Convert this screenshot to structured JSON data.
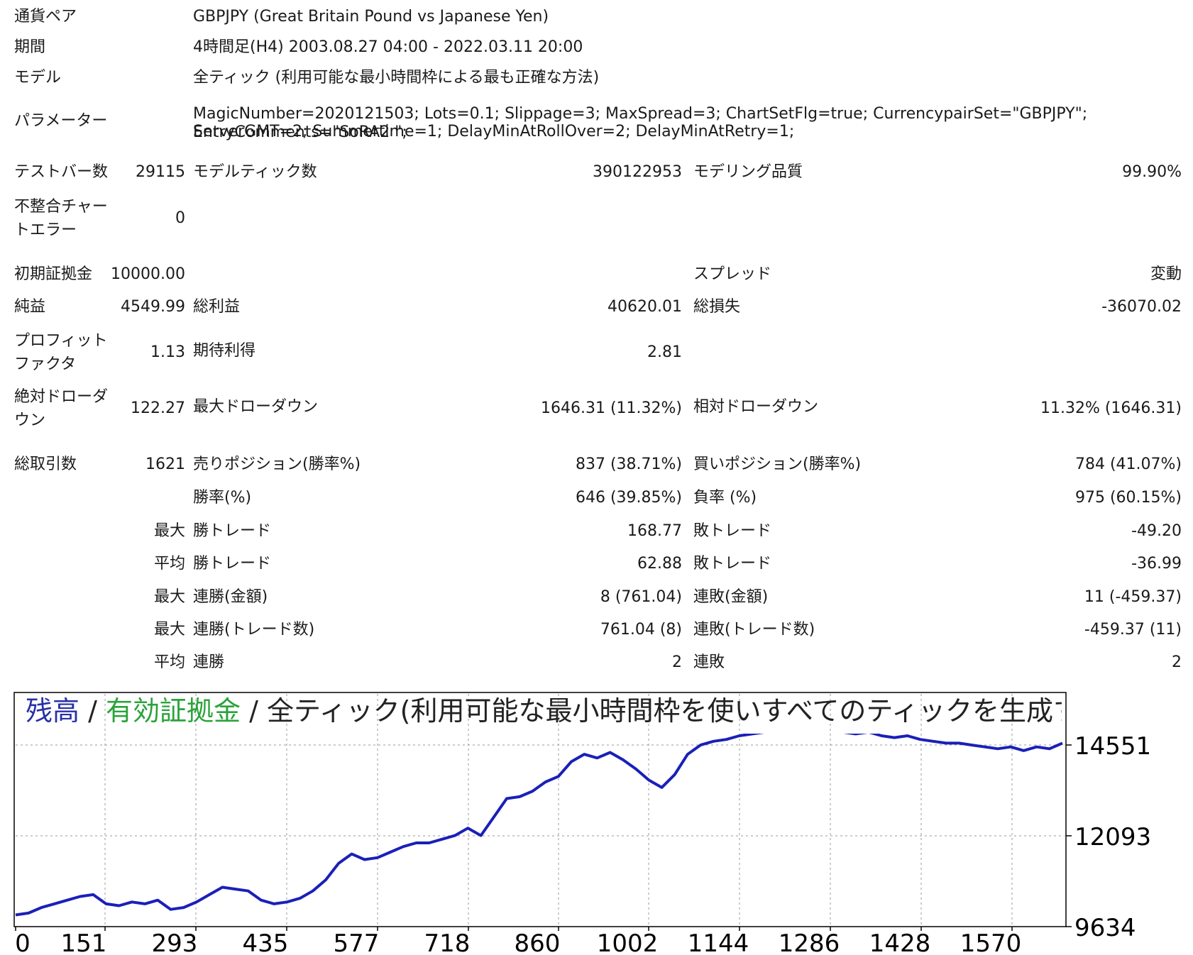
{
  "header": {
    "pair_label": "通貨ペア",
    "pair_value": "GBPJPY (Great Britain Pound vs Japanese Yen)",
    "period_label": "期間",
    "period_value": "4時間足(H4) 2003.08.27 04:00 - 2022.03.11 20:00",
    "model_label": "モデル",
    "model_value": "全ティック (利用可能な最小時間枠による最も正確な方法)",
    "params_label": "パラメーター",
    "params_line1": "MagicNumber=2020121503; Lots=0.1; Slippage=3; MaxSpread=3; ChartSetFlg=true; CurrencypairSet=\"GBPJPY\"; EntryComments=\"SoRA2 \";",
    "params_line2": "ServerGMT=2; Summertime=1; DelayMinAtRollOver=2; DelayMinAtRetry=1;"
  },
  "stats": {
    "bars_label": "テストバー数",
    "bars_value": "29115",
    "ticks_label": "モデルティック数",
    "ticks_value": "390122953",
    "quality_label": "モデリング品質",
    "quality_value": "99.90%",
    "mismatch_label": "不整合チャートエラー",
    "mismatch_value": "0",
    "deposit_label": "初期証拠金",
    "deposit_value": "10000.00",
    "spread_label": "スプレッド",
    "spread_value": "変動",
    "net_label": "純益",
    "net_value": "4549.99",
    "gross_profit_label": "総利益",
    "gross_profit_value": "40620.01",
    "gross_loss_label": "総損失",
    "gross_loss_value": "-36070.02",
    "pf_label": "プロフィットファクタ",
    "pf_value": "1.13",
    "expected_label": "期待利得",
    "expected_value": "2.81",
    "abs_dd_label": "絶対ドローダウン",
    "abs_dd_value": "122.27",
    "max_dd_label": "最大ドローダウン",
    "max_dd_value": "1646.31 (11.32%)",
    "rel_dd_label": "相対ドローダウン",
    "rel_dd_value": "11.32% (1646.31)",
    "trades_label": "総取引数",
    "trades_value": "1621",
    "short_label": "売りポジション(勝率%)",
    "short_value": "837 (38.71%)",
    "long_label": "買いポジション(勝率%)",
    "long_value": "784 (41.07%)",
    "win_label": "勝率(%)",
    "win_value": "646 (39.85%)",
    "loss_label": "負率 (%)",
    "loss_value": "975 (60.15%)",
    "largest_label": "最大",
    "largest_win_label": "勝トレード",
    "largest_win_value": "168.77",
    "largest_loss_label": "敗トレード",
    "largest_loss_value": "-49.20",
    "average_label": "平均",
    "avg_win_label": "勝トレード",
    "avg_win_value": "62.88",
    "avg_loss_label": "敗トレード",
    "avg_loss_value": "-36.99",
    "max_label_1": "最大",
    "consec_win_money_label": "連勝(金額)",
    "consec_win_money_value": "8 (761.04)",
    "consec_loss_money_label": "連敗(金額)",
    "consec_loss_money_value": "11 (-459.37)",
    "max_label_2": "最大",
    "consec_win_count_label": "連勝(トレード数)",
    "consec_win_count_value": "761.04 (8)",
    "consec_loss_count_label": "連敗(トレード数)",
    "consec_loss_count_value": "-459.37 (11)",
    "avg_label_2": "平均",
    "avg_consec_win_label": "連勝",
    "avg_consec_win_value": "2",
    "avg_consec_loss_label": "連敗",
    "avg_consec_loss_value": "2"
  },
  "chart_title": {
    "balance": "残高",
    "sep1": " / ",
    "equity": "有効証拠金",
    "rest": " / 全ティック(利用可能な最小時間枠を使いすべてのティックを生成する、最も"
  },
  "chart_data": {
    "type": "line",
    "title": "残高 / 有効証拠金 / 全ティック(利用可能な最小時間枠を使いすべてのティックを生成する、最も",
    "xlabel": "",
    "ylabel": "",
    "x_ticks": [
      0,
      151,
      293,
      435,
      577,
      718,
      860,
      1002,
      1144,
      1286,
      1428,
      1570
    ],
    "y_ticks": [
      9634,
      12093,
      14551
    ],
    "xlim": [
      0,
      1620
    ],
    "ylim": [
      9634,
      14551
    ],
    "grid": true,
    "series": [
      {
        "color": "#1a20b8",
        "x": [
          0,
          20,
          40,
          60,
          80,
          100,
          120,
          140,
          160,
          180,
          200,
          220,
          240,
          260,
          280,
          300,
          320,
          340,
          360,
          380,
          400,
          420,
          440,
          460,
          480,
          500,
          520,
          540,
          560,
          580,
          600,
          620,
          640,
          660,
          680,
          700,
          720,
          740,
          760,
          780,
          800,
          820,
          840,
          860,
          880,
          900,
          920,
          940,
          960,
          980,
          1000,
          1020,
          1040,
          1060,
          1080,
          1100,
          1120,
          1140,
          1160,
          1180,
          1200,
          1220,
          1240,
          1260,
          1280,
          1300,
          1320,
          1340,
          1360,
          1380,
          1400,
          1420,
          1440,
          1460,
          1480,
          1500,
          1520,
          1540,
          1560,
          1580,
          1600,
          1620
        ],
        "values": [
          9950,
          10000,
          10150,
          10250,
          10350,
          10450,
          10500,
          10250,
          10200,
          10300,
          10250,
          10350,
          10100,
          10150,
          10300,
          10500,
          10700,
          10650,
          10600,
          10350,
          10250,
          10300,
          10400,
          10600,
          10900,
          11350,
          11600,
          11450,
          11500,
          11650,
          11800,
          11900,
          11900,
          12000,
          12100,
          12300,
          12100,
          12600,
          13100,
          13150,
          13300,
          13550,
          13700,
          14100,
          14300,
          14200,
          14350,
          14150,
          13900,
          13600,
          13400,
          13750,
          14300,
          14550,
          14650,
          14700,
          14800,
          14850,
          14900,
          14950,
          14900,
          14950,
          14900,
          14950,
          14900,
          14850,
          14900,
          14800,
          14750,
          14800,
          14700,
          14650,
          14600,
          14600,
          14550,
          14500,
          14450,
          14500,
          14400,
          14500,
          14450,
          14600
        ]
      }
    ]
  }
}
